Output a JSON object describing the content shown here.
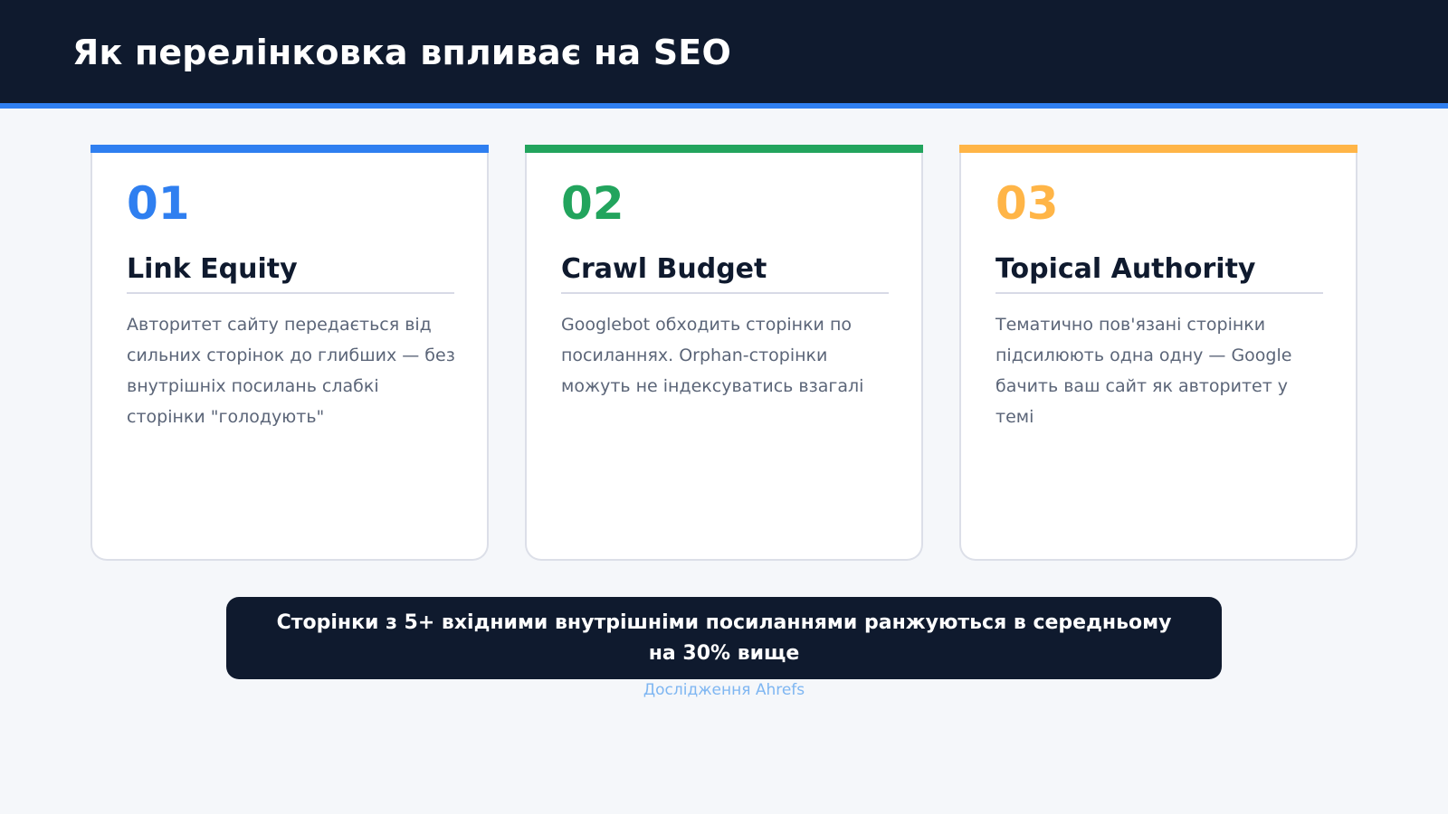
{
  "header": {
    "title": "Як перелінковка впливає на SEO"
  },
  "cards": [
    {
      "number": "01",
      "title": "Link Equity",
      "text": "Авторитет сайту передається від сильних сторінок до глибших — без внутрішніх посилань слабкі сторінки \"голодують\"",
      "accent_color": "#2f7ff0"
    },
    {
      "number": "02",
      "title": "Crawl Budget",
      "text": "Googlebot обходить сторінки по посиланнях. Orphan-сторінки можуть не індексуватись взагалі",
      "accent_color": "#22a45d"
    },
    {
      "number": "03",
      "title": "Topical Authority",
      "text": "Тематично пов'язані сторінки підсилюють одна одну — Google бачить ваш сайт як авторитет у темі",
      "accent_color": "#ffb547"
    }
  ],
  "stat": {
    "text": "Сторінки з 5+ вхідними внутрішніми посиланнями ранжуються в середньому на 30% вище",
    "source": "Дослідження Ahrefs"
  },
  "colors": {
    "header_bg": "#0f1a2e",
    "primary_accent": "#2f7ff0",
    "page_bg": "#f5f7fa",
    "source_text": "#7eb6f2"
  }
}
